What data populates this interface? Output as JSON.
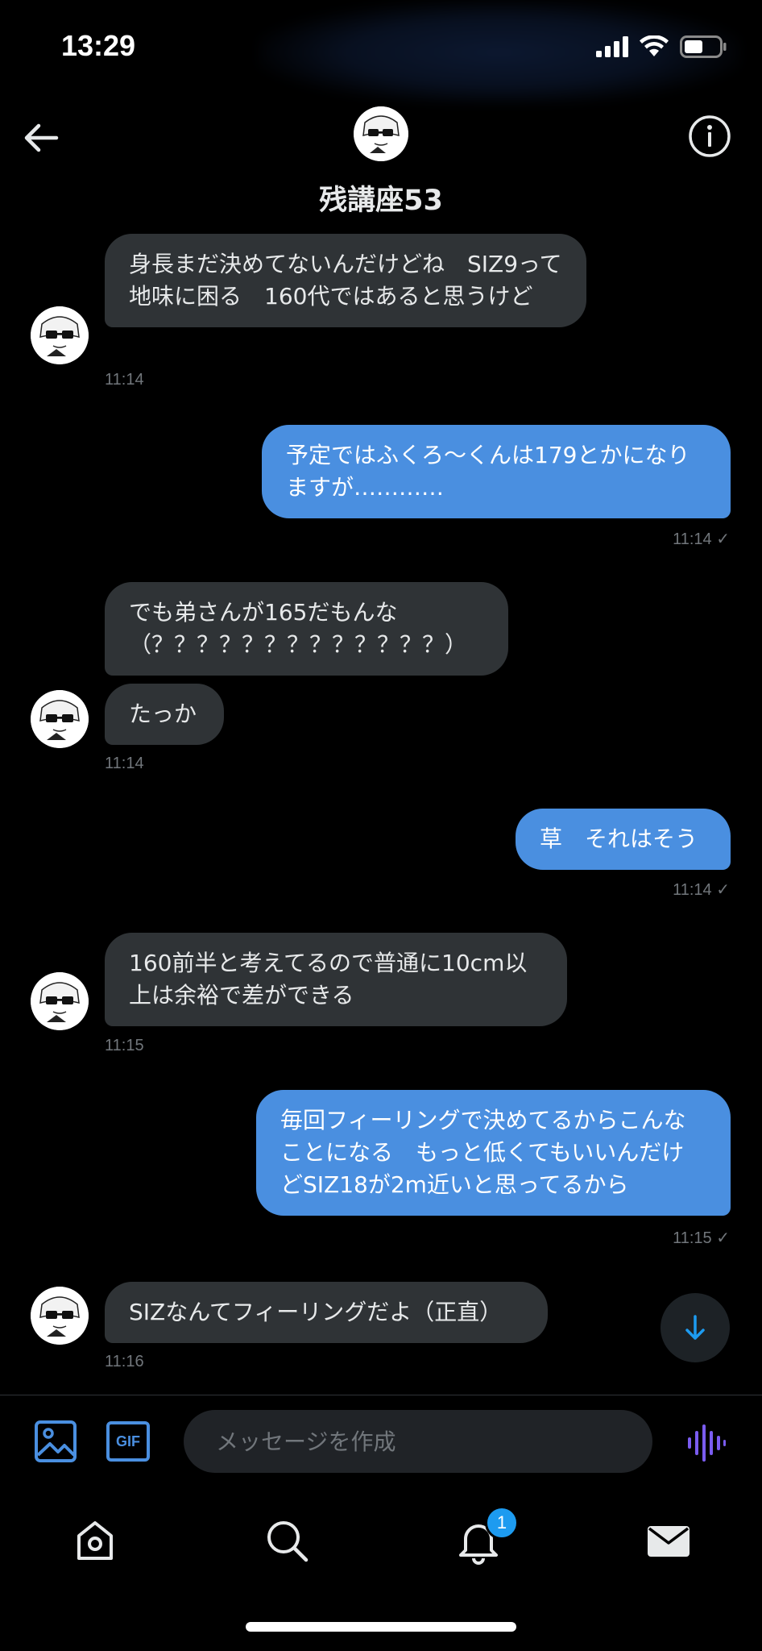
{
  "status_bar": {
    "time": "13:29"
  },
  "header": {
    "title": "残講座53"
  },
  "messages": [
    {
      "direction": "incoming",
      "text": "身長まだ決めてないんだけどね　SIZ9って地味に困る　160代ではあると思うけど",
      "time": "11:14"
    },
    {
      "direction": "outgoing",
      "text": "予定ではふくろ〜くんは179とかになりますが…………",
      "time": "11:14 ✓"
    },
    {
      "direction": "incoming",
      "text": "でも弟さんが165だもんな（？？？？？？？？？？？？？）",
      "time": ""
    },
    {
      "direction": "incoming",
      "text": "たっか",
      "time": "11:14"
    },
    {
      "direction": "outgoing",
      "text": "草　それはそう",
      "time": "11:14 ✓"
    },
    {
      "direction": "incoming",
      "text": "160前半と考えてるので普通に10cm以上は余裕で差ができる",
      "time": "11:15"
    },
    {
      "direction": "outgoing",
      "text": "毎回フィーリングで決めてるからこんなことになる　もっと低くてもいいんだけどSIZ18が2m近いと思ってるから",
      "time": "11:15 ✓"
    },
    {
      "direction": "incoming",
      "text": "SIZなんてフィーリングだよ（正直）",
      "time": "11:16"
    }
  ],
  "composer": {
    "gif_label": "GIF",
    "placeholder": "メッセージを作成"
  },
  "tabbar": {
    "notifications_badge": "1"
  },
  "colors": {
    "outgoing_bubble": "#4a8fe0",
    "incoming_bubble": "#2f3336",
    "accent": "#1d9bf0"
  }
}
